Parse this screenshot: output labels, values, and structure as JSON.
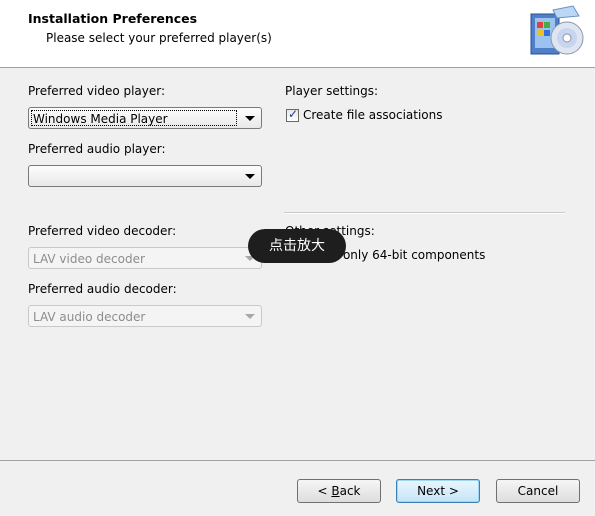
{
  "header": {
    "title": "Installation Preferences",
    "subtitle": "Please select your preferred player(s)",
    "icon": "install-disc-icon"
  },
  "left": {
    "video_player_label": "Preferred video player:",
    "video_player_value": "Windows Media Player",
    "audio_player_label": "Preferred audio player:",
    "audio_player_value": "",
    "video_decoder_label": "Preferred video decoder:",
    "video_decoder_value": "LAV video decoder",
    "audio_decoder_label": "Preferred audio decoder:",
    "audio_decoder_value": "LAV audio decoder"
  },
  "right": {
    "player_settings_label": "Player settings:",
    "file_assoc_label": "Create file associations",
    "file_assoc_checked": true,
    "other_settings_label": "Other settings:",
    "only64_label": "Install only 64-bit components",
    "only64_checked": false
  },
  "overlay": {
    "zoom_tooltip": "点击放大"
  },
  "footer": {
    "back_prefix": "< ",
    "back_mnemonic": "B",
    "back_rest": "ack",
    "next_label": "Next >",
    "cancel_label": "Cancel"
  }
}
